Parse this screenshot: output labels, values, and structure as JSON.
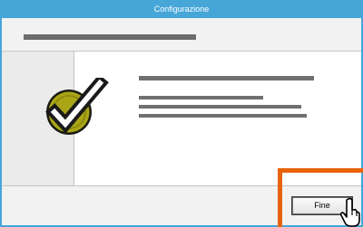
{
  "window": {
    "title": "Configurazione"
  },
  "footer": {
    "finish_label": "Fine"
  },
  "icons": {
    "success": "checkmark-icon",
    "pointer": "mouse-cursor-icon"
  },
  "colors": {
    "titlebar": "#46a6d8",
    "highlight": "#e8640c",
    "check_circle": "#a9a516"
  }
}
